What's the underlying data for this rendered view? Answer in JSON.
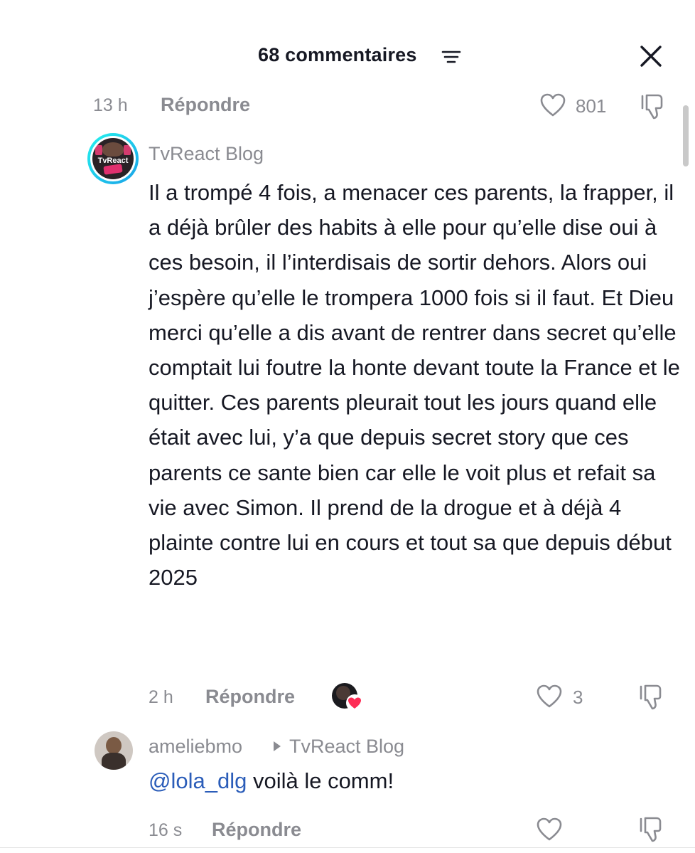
{
  "header": {
    "title": "68 commentaires"
  },
  "previous_comment": {
    "time": "13 h",
    "reply_label": "Répondre",
    "likes": "801"
  },
  "main_comment": {
    "avatar_text": "TvReact Blog",
    "username": "TvReact Blog",
    "text": "Il a trompé 4 fois, a menacer ces parents, la frapper, il a déjà brûler des habits à elle pour qu’elle dise oui à ces besoin, il l’interdisais de sortir dehors. Alors oui j’espère qu’elle le trompera 1000 fois si il faut. Et Dieu merci qu’elle a dis avant de rentrer dans secret qu’elle comptait lui foutre la honte devant toute la France et le quitter. Ces parents pleurait tout les jours quand elle était avec lui, y’a que depuis secret story que ces parents ce sante bien car elle le voit plus et refait sa vie avec Simon. Il prend de la drogue et à déjà 4 plainte contre lui en cours et tout sa que depuis début 2025",
    "time": "2 h",
    "reply_label": "Répondre",
    "likes": "3"
  },
  "reply_comment": {
    "username": "ameliebmo",
    "reply_to": "TvReact Blog",
    "mention": "@lola_dlg",
    "text": " voilà le comm!",
    "time": "16 s",
    "reply_label": "Répondre"
  },
  "colors": {
    "text": "#161823",
    "secondary": "#8a8b91",
    "mention": "#2b5db9",
    "heart_badge": "#fe2c55"
  }
}
